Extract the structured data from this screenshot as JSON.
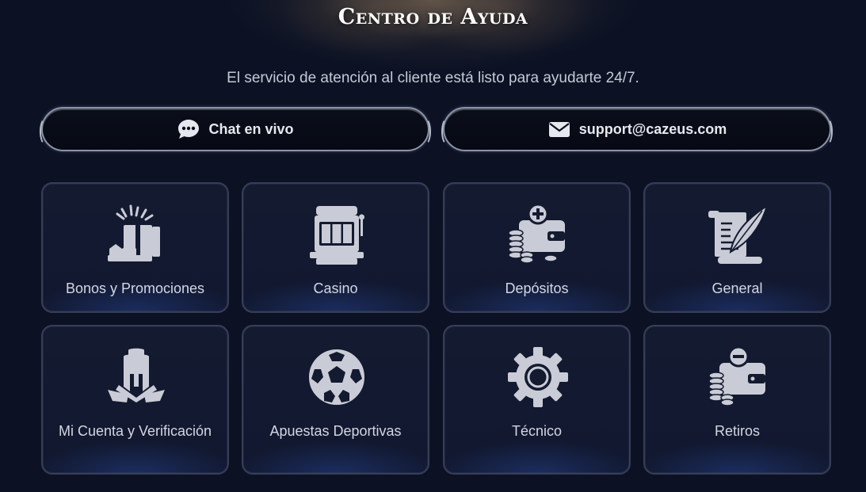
{
  "header": {
    "title": "Centro de Ayuda",
    "subtitle": "El servicio de atención al cliente está listo para ayudarte 24/7."
  },
  "contact": {
    "chat": {
      "label": "Chat en vivo",
      "icon": "chat-bubble-icon"
    },
    "email": {
      "label": "support@cazeus.com",
      "icon": "envelope-icon"
    }
  },
  "categories": [
    {
      "label": "Bonos y Promociones",
      "icon": "gift-box-icon"
    },
    {
      "label": "Casino",
      "icon": "slot-machine-icon"
    },
    {
      "label": "Depósitos",
      "icon": "wallet-plus-icon"
    },
    {
      "label": "General",
      "icon": "scroll-quill-icon"
    },
    {
      "label": "Mi Cuenta y Verificación",
      "icon": "spartan-helmet-icon"
    },
    {
      "label": "Apuestas Deportivas",
      "icon": "soccer-ball-icon"
    },
    {
      "label": "Técnico",
      "icon": "gear-icon"
    },
    {
      "label": "Retiros",
      "icon": "wallet-minus-icon"
    }
  ],
  "colors": {
    "background": "#0c1224",
    "card_border": "#363e57",
    "icon": "#c9ccd6",
    "text": "#d3d7e2"
  }
}
